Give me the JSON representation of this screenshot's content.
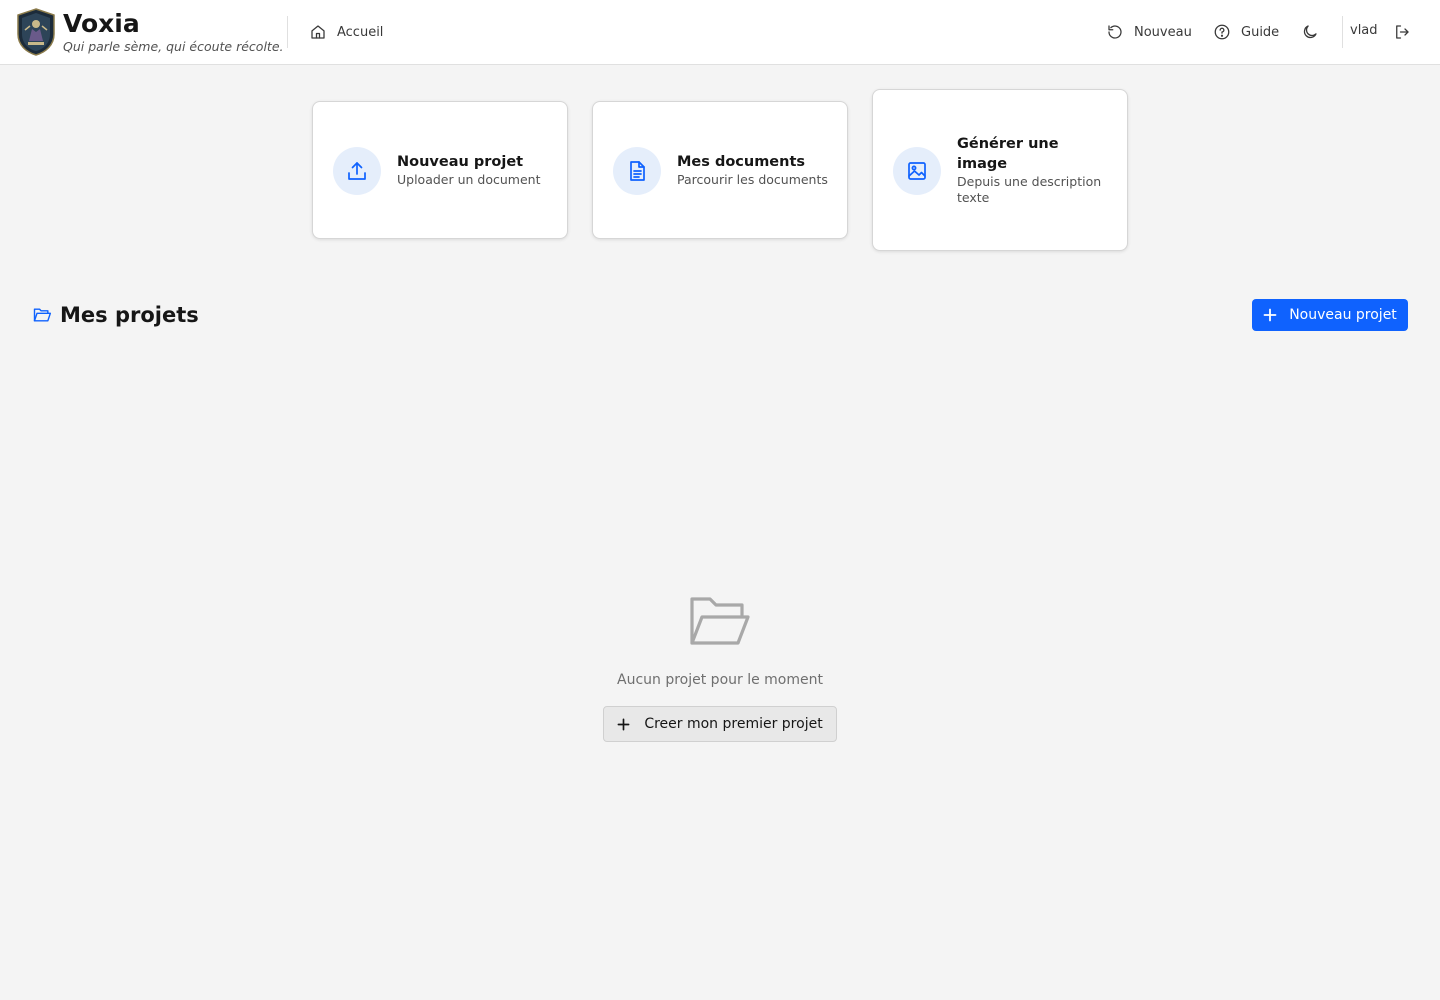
{
  "app": {
    "title": "Voxia",
    "tagline": "Qui parle sème, qui écoute récolte."
  },
  "nav": {
    "home": {
      "label": "Accueil",
      "icon": "home-icon"
    },
    "new": {
      "label": "Nouveau",
      "icon": "refresh-icon"
    },
    "guide": {
      "label": "Guide",
      "icon": "help-circle-icon"
    },
    "theme_icon": "moon-icon",
    "user": "vlad",
    "logout_icon": "logout-icon"
  },
  "quick_actions": [
    {
      "title": "Nouveau projet",
      "subtitle": "Uploader un document",
      "icon": "upload-icon"
    },
    {
      "title": "Mes documents",
      "subtitle": "Parcourir les documents",
      "icon": "document-icon"
    },
    {
      "title": "Générer une image",
      "subtitle": "Depuis une description texte",
      "icon": "image-icon"
    }
  ],
  "projects": {
    "title": "Mes projets",
    "icon": "folder-open-icon",
    "new_button": "Nouveau projet",
    "empty_message": "Aucun projet pour le moment",
    "empty_button": "Creer mon premier projet"
  },
  "colors": {
    "accent": "#0f62fe",
    "background": "#f4f4f4",
    "surface": "#ffffff",
    "icon_bg": "#e5eefb"
  }
}
